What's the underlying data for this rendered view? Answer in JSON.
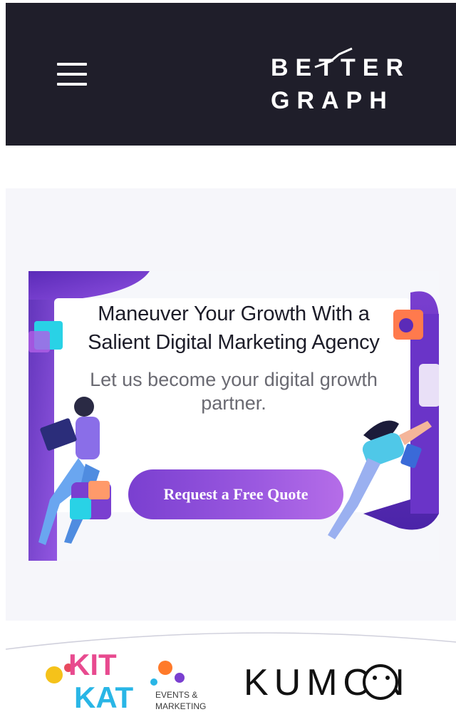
{
  "header": {
    "logo_line1": "BETTER",
    "logo_line2": "GRAPH",
    "menu_icon": "hamburger-icon",
    "background_color": "#1f1e2a"
  },
  "hero": {
    "title": "Maneuver Your Growth With a Salient Digital Marketing Agency",
    "subtitle": "Let us become your digital growth partner.",
    "cta_label": "Request a Free Quote",
    "accent_color": "#7a3fd0"
  },
  "clients": {
    "kitkat": {
      "word1": "KIT",
      "word2": "KAT",
      "tagline1": "EVENTS &",
      "tagline2": "MARKETING"
    },
    "kumon": {
      "name": "KUMON"
    }
  }
}
